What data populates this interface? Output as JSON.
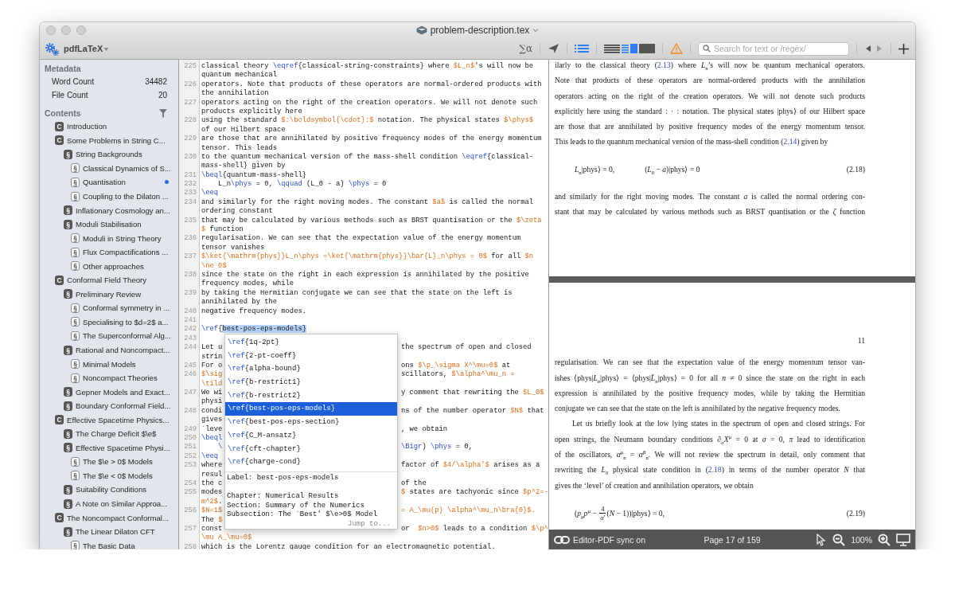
{
  "window": {
    "title": "problem-description.tex"
  },
  "toolbar": {
    "engine": "pdfLaTeX",
    "symbols": "∑α",
    "layout": [
      {
        "kind": "editor",
        "selected": false
      },
      {
        "kind": "split",
        "selected": true
      },
      {
        "kind": "pdf",
        "selected": false
      }
    ],
    "search": {
      "placeholder": "Search for text or /regex/"
    }
  },
  "sidebar": {
    "metadata_title": "Metadata",
    "metadata": [
      {
        "label": "Word Count",
        "value": "34482"
      },
      {
        "label": "File Count",
        "value": "20"
      }
    ],
    "contents_title": "Contents",
    "contents": [
      {
        "kind": "chapter",
        "badge": "C",
        "title": "Introduction",
        "current": false
      },
      {
        "kind": "chapter",
        "badge": "C",
        "title": "Some Problems in String C...",
        "current": false,
        "children": [
          {
            "kind": "section",
            "badge": "§",
            "title": "String Backgrounds",
            "current": false,
            "children": [
              {
                "kind": "subsection",
                "badge": "§",
                "title": "Classical Dynamics of S...",
                "current": false
              },
              {
                "kind": "subsection",
                "badge": "§",
                "title": "Quantisation",
                "current": true
              },
              {
                "kind": "subsection",
                "badge": "§",
                "title": "Coupling to the Dilaton ...",
                "current": false
              }
            ]
          },
          {
            "kind": "section",
            "badge": "§",
            "title": "Inflationary Cosmology an...",
            "current": false
          },
          {
            "kind": "section",
            "badge": "§",
            "title": "Moduli Stabilisation",
            "current": false,
            "children": [
              {
                "kind": "subsection",
                "badge": "§",
                "title": "Moduli in String Theory",
                "current": false
              },
              {
                "kind": "subsection",
                "badge": "§",
                "title": "Flux Compactifications ...",
                "current": false
              },
              {
                "kind": "subsection",
                "badge": "§",
                "title": "Other approaches",
                "current": false
              }
            ]
          }
        ]
      },
      {
        "kind": "chapter",
        "badge": "C",
        "title": "Conformal Field Theory",
        "current": false,
        "children": [
          {
            "kind": "section",
            "badge": "§",
            "title": "Preliminary Review",
            "current": false,
            "children": [
              {
                "kind": "subsection",
                "badge": "§",
                "title": "Conformal symmetry in ...",
                "current": false
              },
              {
                "kind": "subsection",
                "badge": "§",
                "title": "Specialising to $d=2$ a...",
                "current": false
              },
              {
                "kind": "subsection",
                "badge": "§",
                "title": "The Superconformal Alg...",
                "current": false
              }
            ]
          },
          {
            "kind": "section",
            "badge": "§",
            "title": "Rational and Noncompact...",
            "current": false,
            "children": [
              {
                "kind": "subsection",
                "badge": "§",
                "title": "Minimal Models",
                "current": false
              },
              {
                "kind": "subsection",
                "badge": "§",
                "title": "Noncompact Theories",
                "current": false
              }
            ]
          },
          {
            "kind": "section",
            "badge": "§",
            "title": "Gepner Models and Exact...",
            "current": false
          },
          {
            "kind": "section",
            "badge": "§",
            "title": "Boundary Conformal Field...",
            "current": false
          }
        ]
      },
      {
        "kind": "chapter",
        "badge": "C",
        "title": "Effective Spacetime Physics...",
        "current": false,
        "children": [
          {
            "kind": "section",
            "badge": "§",
            "title": "The Charge Deficit $\\e$",
            "current": false
          },
          {
            "kind": "section",
            "badge": "§",
            "title": "Effective Spacetime Physi...",
            "current": false,
            "children": [
              {
                "kind": "subsection",
                "badge": "§",
                "title": "The $\\e > 0$ Models",
                "current": false
              },
              {
                "kind": "subsection",
                "badge": "§",
                "title": "The $\\e < 0$ Models",
                "current": false
              }
            ]
          },
          {
            "kind": "section",
            "badge": "§",
            "title": "Suitability Conditions",
            "current": false
          },
          {
            "kind": "section",
            "badge": "§",
            "title": "A Note on Similar Approa...",
            "current": false
          }
        ]
      },
      {
        "kind": "chapter",
        "badge": "C",
        "title": "The Noncompact Conformal...",
        "current": false,
        "children": [
          {
            "kind": "section",
            "badge": "§",
            "title": "The Linear Dilaton CFT",
            "current": false,
            "children": [
              {
                "kind": "subsection",
                "badge": "§",
                "title": "The Basic Data",
                "current": false
              }
            ]
          }
        ]
      }
    ]
  },
  "editor": {
    "lines": [
      {
        "number": "225",
        "rows": [
          {
            "segments": [
              {
                "text": "classical theory ",
                "kind": "plain"
              },
              {
                "text": "\\eqref",
                "kind": "command"
              },
              {
                "text": "{classical-string-constraints} where ",
                "kind": "plain"
              },
              {
                "text": "$L_n$",
                "kind": "math"
              },
              {
                "text": "'s will now be",
                "kind": "plain"
              }
            ]
          },
          {
            "segments": [
              {
                "text": "quantum mechanical",
                "kind": "plain"
              }
            ]
          }
        ]
      },
      {
        "number": "226",
        "rows": [
          {
            "segments": [
              {
                "text": "operators. Note that products of these operators are normal-ordered products with",
                "kind": "plain"
              }
            ]
          },
          {
            "segments": [
              {
                "text": "the annihilation",
                "kind": "plain"
              }
            ]
          }
        ]
      },
      {
        "number": "227",
        "rows": [
          {
            "segments": [
              {
                "text": "operators acting on the right of the creation operators. We will not denote such",
                "kind": "plain"
              }
            ]
          },
          {
            "segments": [
              {
                "text": "products explicitly here",
                "kind": "plain"
              }
            ]
          }
        ]
      },
      {
        "number": "228",
        "rows": [
          {
            "segments": [
              {
                "text": "using the standard ",
                "kind": "plain"
              },
              {
                "text": "$:\\boldsymbol{\\cdot}:$",
                "kind": "math"
              },
              {
                "text": " notation. The physical states ",
                "kind": "plain"
              },
              {
                "text": "$\\phys$",
                "kind": "math"
              }
            ]
          },
          {
            "segments": [
              {
                "text": "of our Hilbert space",
                "kind": "plain"
              }
            ]
          }
        ]
      },
      {
        "number": "229",
        "rows": [
          {
            "segments": [
              {
                "text": "are those that are annihilated by positive frequency modes of the energy momentum",
                "kind": "plain"
              }
            ]
          },
          {
            "segments": [
              {
                "text": "tensor. This leads",
                "kind": "plain"
              }
            ]
          }
        ]
      },
      {
        "number": "230",
        "rows": [
          {
            "segments": [
              {
                "text": "to the quantum mechanical version of the mass-shell condition ",
                "kind": "plain"
              },
              {
                "text": "\\eqref",
                "kind": "command"
              },
              {
                "text": "{classical-",
                "kind": "plain"
              }
            ]
          },
          {
            "segments": [
              {
                "text": "mass-shell} given by",
                "kind": "plain"
              }
            ]
          }
        ]
      },
      {
        "number": "231",
        "rows": [
          {
            "segments": [
              {
                "text": "\\beql",
                "kind": "command"
              },
              {
                "text": "{quantum-mass-shell}",
                "kind": "plain"
              }
            ]
          }
        ]
      },
      {
        "number": "232",
        "rows": [
          {
            "segments": [
              {
                "text": "    L_n",
                "kind": "plain"
              },
              {
                "text": "\\phys",
                "kind": "command"
              },
              {
                "text": " = 0, ",
                "kind": "plain"
              },
              {
                "text": "\\qquad",
                "kind": "command"
              },
              {
                "text": " (L_0 - a) ",
                "kind": "plain"
              },
              {
                "text": "\\phys",
                "kind": "command"
              },
              {
                "text": " = 0",
                "kind": "plain"
              }
            ]
          }
        ]
      },
      {
        "number": "233",
        "rows": [
          {
            "segments": [
              {
                "text": "\\eeq",
                "kind": "command"
              }
            ]
          }
        ]
      },
      {
        "number": "234",
        "rows": [
          {
            "segments": [
              {
                "text": "and similarly for the right moving modes. The constant ",
                "kind": "plain"
              },
              {
                "text": "$a$",
                "kind": "math"
              },
              {
                "text": " is called the normal",
                "kind": "plain"
              }
            ]
          },
          {
            "segments": [
              {
                "text": "ordering constant",
                "kind": "plain"
              }
            ]
          }
        ]
      },
      {
        "number": "235",
        "rows": [
          {
            "segments": [
              {
                "text": "that may be calculated by various methods such as BRST quantisation or the ",
                "kind": "plain"
              },
              {
                "text": "$\\zeta",
                "kind": "math"
              }
            ]
          },
          {
            "segments": [
              {
                "text": "$",
                "kind": "math"
              },
              {
                "text": " function",
                "kind": "plain"
              }
            ]
          }
        ]
      },
      {
        "number": "236",
        "rows": [
          {
            "segments": [
              {
                "text": "regularisation. We can see that the expectation value of the energy momentum",
                "kind": "plain"
              }
            ]
          },
          {
            "segments": [
              {
                "text": "tensor vanishes",
                "kind": "plain"
              }
            ]
          }
        ]
      },
      {
        "number": "237",
        "rows": [
          {
            "segments": [
              {
                "text": "$\\ket{\\mathrm{phys}}L_n\\phys =\\ket{\\mathrm{phys}}\\bar{L}_n\\phys = 0$",
                "kind": "math"
              },
              {
                "text": " for all ",
                "kind": "plain"
              },
              {
                "text": "$n",
                "kind": "math"
              }
            ]
          },
          {
            "segments": [
              {
                "text": "\\ne 0$",
                "kind": "math"
              }
            ]
          }
        ]
      },
      {
        "number": "238",
        "rows": [
          {
            "segments": [
              {
                "text": "since the state on the right in each expression is annihilated by the positive",
                "kind": "plain"
              }
            ]
          },
          {
            "segments": [
              {
                "text": "frequency modes, while",
                "kind": "plain"
              }
            ]
          }
        ]
      },
      {
        "number": "239",
        "rows": [
          {
            "segments": [
              {
                "text": "by taking the Hermitian conjugate we can see that the state on the left is",
                "kind": "plain"
              }
            ]
          },
          {
            "segments": [
              {
                "text": "annihilated by the",
                "kind": "plain"
              }
            ]
          }
        ]
      },
      {
        "number": "240",
        "rows": [
          {
            "segments": [
              {
                "text": "negative frequency modes.",
                "kind": "plain"
              }
            ]
          }
        ]
      },
      {
        "number": "241",
        "rows": [
          {
            "segments": []
          }
        ]
      },
      {
        "number": "242",
        "rows": [
          {
            "segments": [
              {
                "text": "\\ref",
                "kind": "command"
              },
              {
                "text": "{",
                "kind": "plain"
              },
              {
                "text": "best-pos-eps-models}",
                "kind": "selected"
              }
            ]
          }
        ]
      },
      {
        "number": "243",
        "rows": [
          {
            "segments": []
          }
        ]
      },
      {
        "number": "244",
        "rows": [
          {
            "segments": [
              {
                "text": "Let u",
                "kind": "plain"
              }
            ],
            "after_popup": [
              {
                "text": "the spectrum of open and closed",
                "kind": "plain"
              }
            ]
          },
          {
            "segments": [
              {
                "text": "strin",
                "kind": "plain"
              }
            ]
          }
        ]
      },
      {
        "number": "245",
        "rows": [
          {
            "segments": [
              {
                "text": "For o",
                "kind": "plain"
              }
            ],
            "after_popup": [
              {
                "text": "ons ",
                "kind": "plain"
              },
              {
                "text": "$\\p_\\sigma X^\\mu=0$",
                "kind": "math"
              },
              {
                "text": " at",
                "kind": "plain"
              }
            ]
          }
        ]
      },
      {
        "number": "246",
        "rows": [
          {
            "segments": [
              {
                "text": "$\\sig",
                "kind": "math"
              }
            ],
            "after_popup": [
              {
                "text": "scillators, ",
                "kind": "plain"
              },
              {
                "text": "$\\alpha^\\mu_n =",
                "kind": "math"
              }
            ]
          },
          {
            "segments": [
              {
                "text": "\\tild",
                "kind": "math"
              }
            ]
          }
        ]
      },
      {
        "number": "247",
        "rows": [
          {
            "segments": [
              {
                "text": "We wi",
                "kind": "plain"
              }
            ],
            "after_popup": [
              {
                "text": "y comment that rewriting the ",
                "kind": "plain"
              },
              {
                "text": "$L_0$",
                "kind": "math"
              }
            ]
          },
          {
            "segments": [
              {
                "text": "physi",
                "kind": "plain"
              }
            ]
          }
        ]
      },
      {
        "number": "248",
        "rows": [
          {
            "segments": [
              {
                "text": "condi",
                "kind": "plain"
              }
            ],
            "after_popup": [
              {
                "text": "ns of the number operator ",
                "kind": "plain"
              },
              {
                "text": "$N$",
                "kind": "math"
              },
              {
                "text": " that",
                "kind": "plain"
              }
            ]
          },
          {
            "segments": [
              {
                "text": "gives",
                "kind": "plain"
              }
            ]
          }
        ]
      },
      {
        "number": "249",
        "rows": [
          {
            "segments": [
              {
                "text": "`leve",
                "kind": "plain"
              }
            ],
            "after_popup": [
              {
                "text": ", we obtain",
                "kind": "plain"
              }
            ]
          }
        ]
      },
      {
        "number": "250",
        "rows": [
          {
            "segments": [
              {
                "text": "\\beql",
                "kind": "command"
              }
            ]
          }
        ]
      },
      {
        "number": "251",
        "rows": [
          {
            "segments": [
              {
                "text": "    \\",
                "kind": "command"
              }
            ],
            "after_popup": [
              {
                "text": "\\Bigr",
                "kind": "command"
              },
              {
                "text": ") ",
                "kind": "plain"
              },
              {
                "text": "\\phys",
                "kind": "command"
              },
              {
                "text": " = 0,",
                "kind": "plain"
              }
            ]
          }
        ]
      },
      {
        "number": "252",
        "rows": [
          {
            "segments": [
              {
                "text": "\\eeq",
                "kind": "command"
              }
            ]
          }
        ]
      },
      {
        "number": "253",
        "rows": [
          {
            "segments": [
              {
                "text": "where",
                "kind": "plain"
              }
            ],
            "after_popup": [
              {
                "text": "factor of ",
                "kind": "plain"
              },
              {
                "text": "$4/\\alpha'$",
                "kind": "math"
              },
              {
                "text": " arises as a",
                "kind": "plain"
              }
            ]
          },
          {
            "segments": [
              {
                "text": "resul",
                "kind": "plain"
              }
            ]
          }
        ]
      },
      {
        "number": "254",
        "rows": [
          {
            "segments": [
              {
                "text": "the c",
                "kind": "plain"
              }
            ],
            "after_popup": [
              {
                "text": "of the",
                "kind": "plain"
              }
            ]
          }
        ]
      },
      {
        "number": "255",
        "rows": [
          {
            "segments": [
              {
                "text": "modes",
                "kind": "plain"
              }
            ],
            "after_popup": [
              {
                "text": "$",
                "kind": "math"
              },
              {
                "text": " states are tachyonic since ",
                "kind": "plain"
              },
              {
                "text": "$p^2=-",
                "kind": "math"
              }
            ]
          },
          {
            "segments": [
              {
                "text": "m^2$",
                "kind": "math"
              },
              {
                "text": ".",
                "kind": "plain"
              }
            ]
          }
        ]
      },
      {
        "number": "256",
        "rows": [
          {
            "segments": [
              {
                "text": "$N=1$",
                "kind": "math"
              }
            ],
            "after_popup": [
              {
                "text": "= A_\\mu(p) \\alpha^\\mu_n\\bra{0}$.",
                "kind": "math"
              }
            ]
          },
          {
            "segments": [
              {
                "text": "The ",
                "kind": "plain"
              },
              {
                "text": "$",
                "kind": "math"
              }
            ]
          }
        ]
      },
      {
        "number": "257",
        "rows": [
          {
            "segments": [
              {
                "text": "const",
                "kind": "plain"
              }
            ],
            "after_popup": [
              {
                "text": "or  ",
                "kind": "plain"
              },
              {
                "text": "$n>0$",
                "kind": "math"
              },
              {
                "text": " leads to a condition ",
                "kind": "plain"
              },
              {
                "text": "$\\p^",
                "kind": "math"
              }
            ]
          },
          {
            "segments": [
              {
                "text": "\\mu A_\\mu=0$",
                "kind": "math"
              }
            ]
          }
        ]
      },
      {
        "number": "258",
        "rows": [
          {
            "segments": [
              {
                "text": "which is the Lorentz gauge condition for an electromagnetic potential.",
                "kind": "plain"
              }
            ]
          }
        ]
      }
    ],
    "completion": {
      "items": [
        {
          "prefix": "\\ref",
          "label": "{1q-2pt}",
          "selected": false
        },
        {
          "prefix": "\\ref",
          "label": "{2-pt-coeff}",
          "selected": false
        },
        {
          "prefix": "\\ref",
          "label": "{alpha-bound}",
          "selected": false
        },
        {
          "prefix": "\\ref",
          "label": "{b-restrict1}",
          "selected": false
        },
        {
          "prefix": "\\ref",
          "label": "{b-restrict2}",
          "selected": false
        },
        {
          "prefix": "\\ref",
          "label": "{best-pos-eps-models}",
          "selected": true
        },
        {
          "prefix": "\\ref",
          "label": "{best-pos-eps-section}",
          "selected": false
        },
        {
          "prefix": "\\ref",
          "label": "{C_M-ansatz}",
          "selected": false
        },
        {
          "prefix": "\\ref",
          "label": "{cft-chapter}",
          "selected": false
        },
        {
          "prefix": "\\ref",
          "label": "{charge-cond}",
          "selected": false
        }
      ],
      "detail": {
        "label": "Label: best-pos-eps-models",
        "chapter": "Chapter: Numerical Results",
        "section": "Section: Summary of the Numerics",
        "subsection": "Subsection: The `Best' $\\e>0$ Model",
        "link": "Jump to..."
      }
    }
  },
  "pdf": {
    "pages": [
      {
        "blocks": [
          {
            "kind": "paragraph",
            "indent": false,
            "continues": false,
            "lines": [
              [
                {
                  "kind": "text",
                  "text": "ilarly to the classical theory ("
                },
                {
                  "kind": "ref",
                  "text": "2.13"
                },
                {
                  "kind": "text",
                  "text": ") where *L*$_{n}$’s will now be quantum mechanical operators."
                }
              ],
              [
                {
                  "kind": "text",
                  "text": "Note that products of these operators are normal-ordered products with the annihilation"
                }
              ],
              [
                {
                  "kind": "text",
                  "text": "operators acting on the right of the creation operators.  We will not denote such products"
                }
              ],
              [
                {
                  "kind": "text",
                  "text": "explicitly here using the standard : · : notation. The physical states |phys⟩ of our Hilbert space"
                }
              ],
              [
                {
                  "kind": "text",
                  "text": "are those that are annihilated by positive frequency modes of the energy momentum tensor."
                }
              ],
              [
                {
                  "kind": "text",
                  "text": "This leads to the quantum mechanical version of the mass-shell condition ("
                },
                {
                  "kind": "ref",
                  "text": "2.14"
                },
                {
                  "kind": "text",
                  "text": ") given by"
                }
              ]
            ]
          },
          {
            "kind": "equation",
            "parts": [
              {
                "kind": "text",
                "text": "*L*$_{n}$|phys⟩ = 0,"
              },
              {
                "kind": "text",
                "text": "(*L*$_{0}$ − *a*)|phys⟩ = 0"
              }
            ],
            "number": "(2.18)"
          },
          {
            "kind": "paragraph",
            "indent": false,
            "continues": true,
            "lines": [
              [
                {
                  "kind": "text",
                  "text": "and similarly for the right moving modes. The constant *a* is called the normal ordering con-"
                }
              ],
              [
                {
                  "kind": "text",
                  "text": "stant that may be calculated by various methods such as BRST quantisation or the *ζ* function"
                }
              ]
            ]
          }
        ]
      },
      {
        "page_number": "11",
        "blocks": [
          {
            "kind": "paragraph",
            "indent": false,
            "continues": false,
            "lines": [
              [
                {
                  "kind": "text",
                  "text": "regularisation.  We can see that the expectation value of the energy momentum tensor van-"
                }
              ],
              [
                {
                  "kind": "text",
                  "text": "ishes ⟨phys|*L*$_{n}$|phys⟩ = ⟨phys|*L̄*$_{n}$|phys⟩ = 0 for all *n* ≠ 0 since the state on the right in each"
                }
              ],
              [
                {
                  "kind": "text",
                  "text": "expression is annihilated by the positive frequency modes, while by taking the Hermitian"
                }
              ],
              [
                {
                  "kind": "text",
                  "text": "conjugate we can see that the state on the left is annihilated by the negative frequency modes."
                }
              ]
            ]
          },
          {
            "kind": "paragraph",
            "indent": true,
            "continues": false,
            "lines": [
              [
                {
                  "kind": "text",
                  "text": "Let us briefly look at the low lying states in the spectrum of open and closed strings. For"
                }
              ],
              [
                {
                  "kind": "text",
                  "text": "open strings, the Neumann boundary conditions *∂*$_{σ}$*X*$^{μ}$ = 0 at *σ* = 0, *π* lead to identification"
                }
              ],
              [
                {
                  "kind": "text",
                  "text": "of the oscillators, *α*$^{μ}$$_{n}$ = *α̃*$^{μ}$$_{n}$. We will not review the spectrum in detail, only comment that"
                }
              ],
              [
                {
                  "kind": "text",
                  "text": "rewriting the *L*$_{0}$ physical state condition in ("
                },
                {
                  "kind": "ref",
                  "text": "2.18"
                },
                {
                  "kind": "text",
                  "text": ") in terms of the number operator *N* that"
                }
              ],
              [
                {
                  "kind": "text",
                  "text": "gives the ‘level’ of creation and annihilation operators, we obtain"
                }
              ]
            ]
          },
          {
            "kind": "equation",
            "parts": [
              {
                "kind": "text",
                "text": "(*p*$_{μ}$*p*$^{μ}$ − "
              },
              {
                "kind": "fraction",
                "numerator": "4",
                "denominator": "*α*′"
              },
              {
                "kind": "text",
                "text": "(*N* − 1))|phys⟩ = 0,"
              }
            ],
            "number": "(2.19)"
          }
        ]
      }
    ],
    "status_bar": {
      "sync": "Editor-PDF sync on",
      "page": "Page 17 of 159",
      "zoom": "100%"
    }
  }
}
